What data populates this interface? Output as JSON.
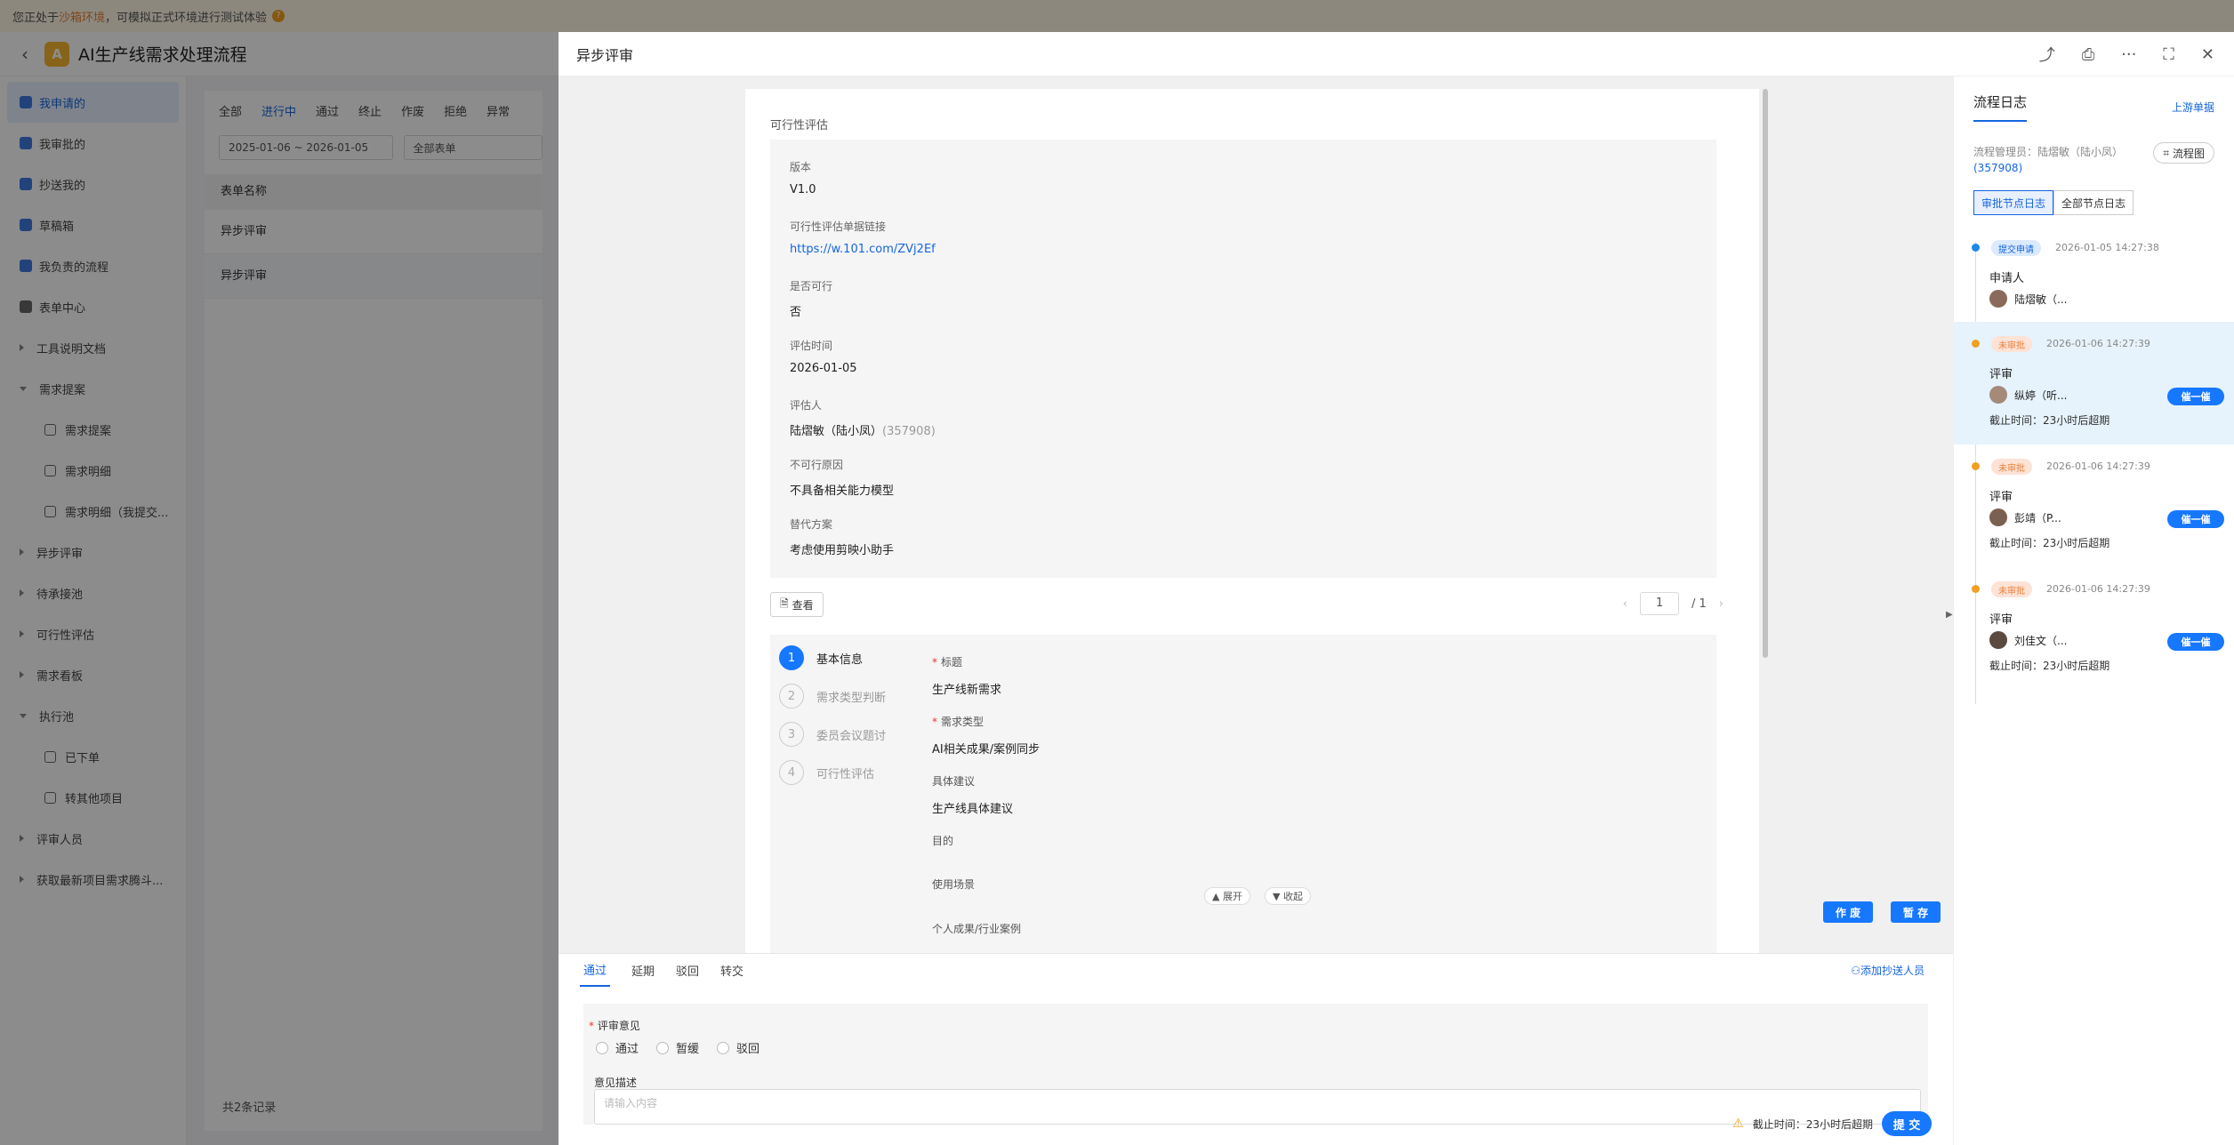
{
  "banner": {
    "prefix": "您正处于",
    "env": "沙箱环境",
    "suffix": "，可模拟正式环境进行测试体验"
  },
  "app": {
    "title": "AI生产线需求处理流程",
    "logo_letter": "A"
  },
  "sidebar": {
    "items": [
      {
        "label": "我申请的"
      },
      {
        "label": "我审批的"
      },
      {
        "label": "抄送我的"
      },
      {
        "label": "草稿箱"
      },
      {
        "label": "我负责的流程"
      },
      {
        "label": "表单中心"
      },
      {
        "label": "工具说明文档"
      },
      {
        "label": "需求提案"
      },
      {
        "label": "需求提案"
      },
      {
        "label": "需求明细"
      },
      {
        "label": "需求明细（我提交..."
      },
      {
        "label": "异步评审"
      },
      {
        "label": "待承接池"
      },
      {
        "label": "可行性评估"
      },
      {
        "label": "需求看板"
      },
      {
        "label": "执行池"
      },
      {
        "label": "已下单"
      },
      {
        "label": "转其他项目"
      },
      {
        "label": "评审人员"
      },
      {
        "label": "获取最新项目需求腾斗..."
      }
    ]
  },
  "list": {
    "tabs": [
      "全部",
      "进行中",
      "通过",
      "终止",
      "作废",
      "拒绝",
      "异常"
    ],
    "date_range": "2025-01-06 ~ 2026-01-05",
    "form_filter": "全部表单",
    "column": "表单名称",
    "rows": [
      "异步评审",
      "异步评审"
    ],
    "count": "共2条记录"
  },
  "drawer": {
    "title": "异步评审",
    "section_title": "可行性评估",
    "fields": [
      {
        "label": "版本",
        "value": "V1.0"
      },
      {
        "label": "可行性评估单据链接",
        "value": "https://w.101.com/ZVj2Ef"
      },
      {
        "label": "是否可行",
        "value": "否"
      },
      {
        "label": "评估时间",
        "value": "2026-01-05"
      },
      {
        "label": "评估人",
        "value": "陆熠敏（陆小凤）",
        "extra": "(357908)"
      },
      {
        "label": "不可行原因",
        "value": "不具备相关能力模型"
      },
      {
        "label": "替代方案",
        "value": "考虑使用剪映小助手"
      }
    ],
    "view_label": "查看",
    "pager": {
      "current": "1",
      "total": "/ 1"
    },
    "steps": [
      "基本信息",
      "需求类型判断",
      "委员会议题讨",
      "可行性评估"
    ],
    "step_numbers": [
      "1",
      "2",
      "3",
      "4"
    ],
    "step_fields": [
      {
        "label": "标题",
        "value": "生产线新需求",
        "required": "*"
      },
      {
        "label": "需求类型",
        "value": "AI相关成果/案例同步",
        "required": "*"
      },
      {
        "label": "具体建议",
        "value": "生产线具体建议",
        "required": ""
      },
      {
        "label": "目的",
        "value": "",
        "required": ""
      },
      {
        "label": "使用场景",
        "value": "",
        "required": ""
      },
      {
        "label": "个人成果/行业案例",
        "value": "",
        "required": ""
      }
    ],
    "expand_label": "展开",
    "collapse_label": "收起",
    "void_button": "作 废",
    "save_button": "暂 存"
  },
  "approve": {
    "tabs": [
      "通过",
      "延期",
      "驳回",
      "转交"
    ],
    "add_cc": "添加抄送人员",
    "opinion_label": "评审意见",
    "options": [
      "通过",
      "暂缓",
      "驳回"
    ],
    "desc_label": "意见描述",
    "desc_placeholder": "请输入内容",
    "deadline": "截止时间：23小时后超期",
    "submit": "提 交"
  },
  "log": {
    "title": "流程日志",
    "upstream": "上游单据",
    "manager": "流程管理员：陆熠敏（陆小凤）",
    "manager_id": "(357908)",
    "flow_chart": "流程图",
    "btn_approval": "审批节点日志",
    "btn_all": "全部节点日志",
    "nodes": [
      {
        "tag": "提交申请",
        "time": "2026-01-05 14:27:38",
        "role": "申请人",
        "who": "陆熠敏（..."
      },
      {
        "tag": "未审批",
        "time": "2026-01-06 14:27:39",
        "role": "评审",
        "who": "纵婷（听...",
        "deadline": "截止时间：23小时后超期",
        "urge": "催一催"
      },
      {
        "tag": "未审批",
        "time": "2026-01-06 14:27:39",
        "role": "评审",
        "who": "彭靖（P...",
        "deadline": "截止时间：23小时后超期",
        "urge": "催一催"
      },
      {
        "tag": "未审批",
        "time": "2026-01-06 14:27:39",
        "role": "评审",
        "who": "刘佳文（...",
        "deadline": "截止时间：23小时后超期",
        "urge": "催一催"
      }
    ]
  },
  "colors": {
    "accent": "#1677ff",
    "pending": "#f0a020",
    "submitted": "#1e88e5"
  }
}
